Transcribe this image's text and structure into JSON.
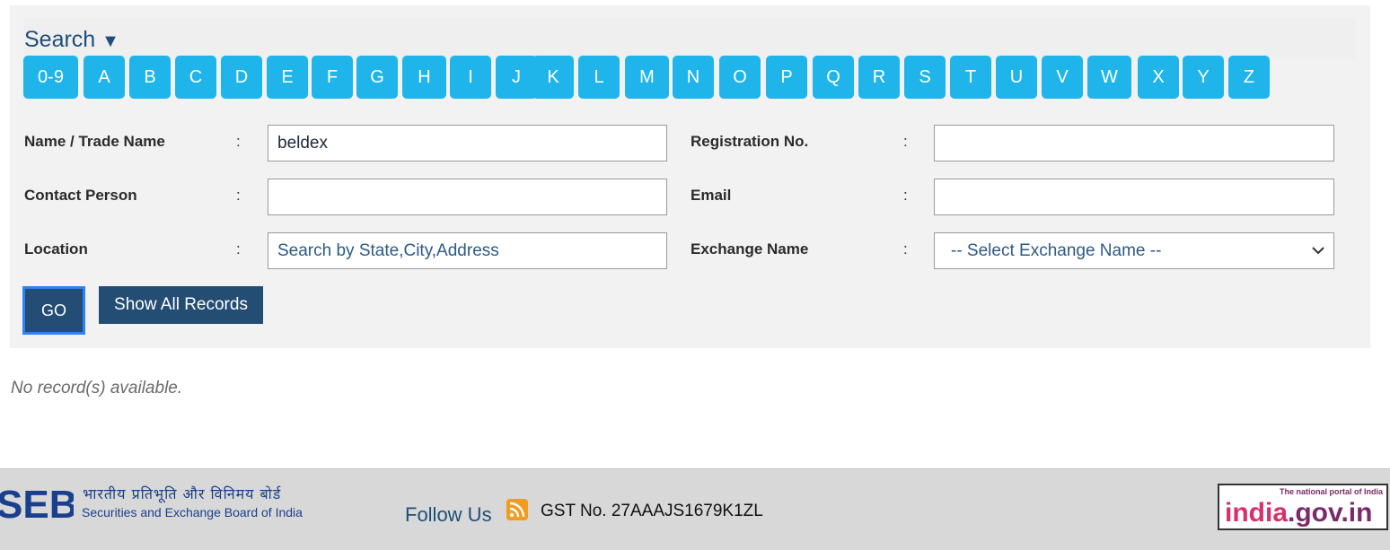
{
  "search": {
    "title": "Search",
    "toggle_icon": "triangle-down-icon",
    "letters": [
      "0-9",
      "A",
      "B",
      "C",
      "D",
      "E",
      "F",
      "G",
      "H",
      "I",
      "J",
      "K",
      "L",
      "M",
      "N",
      "O",
      "P",
      "Q",
      "R",
      "S",
      "T",
      "U",
      "V",
      "W",
      "X",
      "Y",
      "Z"
    ]
  },
  "form": {
    "name_label": "Name / Trade Name",
    "name_value": "beldex",
    "reg_label": "Registration No.",
    "reg_value": "",
    "contact_label": "Contact Person",
    "contact_value": "",
    "email_label": "Email",
    "email_value": "",
    "location_label": "Location",
    "location_placeholder": "Search by State,City,Address",
    "exchange_label": "Exchange Name",
    "exchange_selected": "-- Select Exchange Name --",
    "colon": ":"
  },
  "buttons": {
    "go": "GO",
    "show_all": "Show All Records"
  },
  "results": {
    "message": "No record(s) available."
  },
  "footer": {
    "sebi_logo_text": "SEBI",
    "sebi_hindi": "भारतीय प्रतिभूति और विनिमय बोर्ड",
    "sebi_english": "Securities and Exchange Board of India",
    "follow_us": "Follow Us",
    "rss_icon": "rss-icon",
    "gst": "GST No. 27AAAJS1679K1ZL",
    "india_portal_tag": "The national portal of India",
    "india_portal_word": "india.gov.in"
  },
  "colors": {
    "letter_button": "#1fb5eb",
    "primary_button": "#244d74",
    "title": "#1f4e79",
    "panel": "#f3f2f3",
    "footer": "#d8d8d8"
  }
}
